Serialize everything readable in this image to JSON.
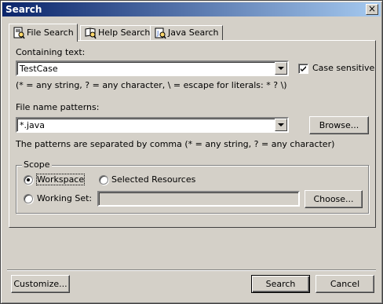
{
  "window": {
    "title": "Search",
    "close_glyph": "×"
  },
  "tabs": [
    {
      "label": "File Search",
      "icon": "file-search-icon",
      "active": true
    },
    {
      "label": "Help Search",
      "icon": "help-search-icon",
      "active": false
    },
    {
      "label": "Java Search",
      "icon": "java-search-icon",
      "active": false
    }
  ],
  "containing": {
    "label": "Containing text:",
    "value": "TestCase",
    "case_sensitive_label": "Case sensitive",
    "case_sensitive_checked": true,
    "hint": "(* = any string, ? = any character, \\ = escape for literals: * ? \\)"
  },
  "patterns": {
    "label": "File name patterns:",
    "value": "*.java",
    "browse_label": "Browse...",
    "hint": "The patterns are separated by comma (* = any string, ? = any character)"
  },
  "scope": {
    "label": "Scope",
    "workspace_label": "Workspace",
    "selected_resources_label": "Selected Resources",
    "working_set_label": "Working Set:",
    "working_set_value": "",
    "choose_label": "Choose...",
    "selected": "workspace"
  },
  "footer": {
    "customize_label": "Customize...",
    "search_label": "Search",
    "cancel_label": "Cancel"
  }
}
